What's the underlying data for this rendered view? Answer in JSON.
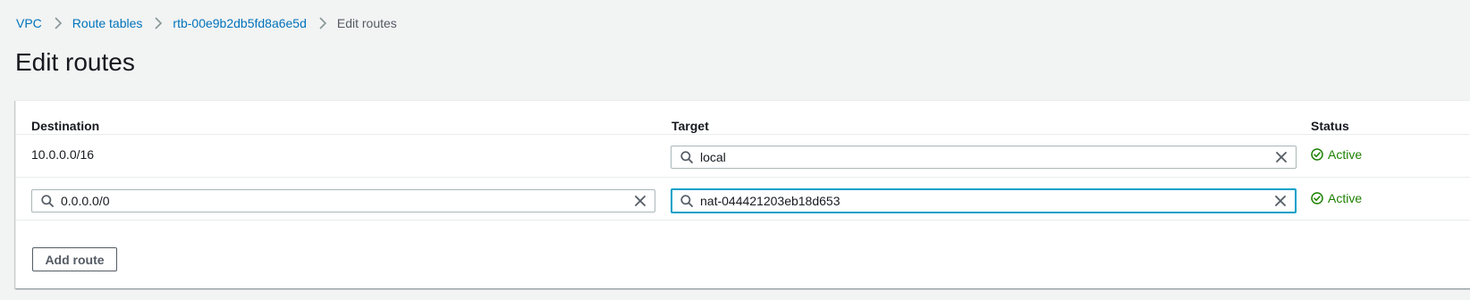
{
  "breadcrumb": {
    "items": [
      "VPC",
      "Route tables",
      "rtb-00e9b2db5fd8a6e5d"
    ],
    "current": "Edit routes"
  },
  "page": {
    "title": "Edit routes"
  },
  "table": {
    "columns": {
      "destination": "Destination",
      "target": "Target",
      "status": "Status"
    },
    "rows": [
      {
        "destination": "10.0.0.0/16",
        "target": "local",
        "status": "Active"
      },
      {
        "destination": "0.0.0.0/0",
        "target": "nat-044421203eb18d653",
        "status": "Active"
      }
    ]
  },
  "actions": {
    "add_route": "Add route"
  },
  "icons": {
    "search": "search-icon",
    "clear": "close-icon",
    "status": "check-circle-icon",
    "separator": "chevron-right-icon"
  },
  "colors": {
    "link": "#0073bb",
    "status_active": "#1d8102",
    "focus": "#00a1c9",
    "background": "#f2f3f3"
  }
}
